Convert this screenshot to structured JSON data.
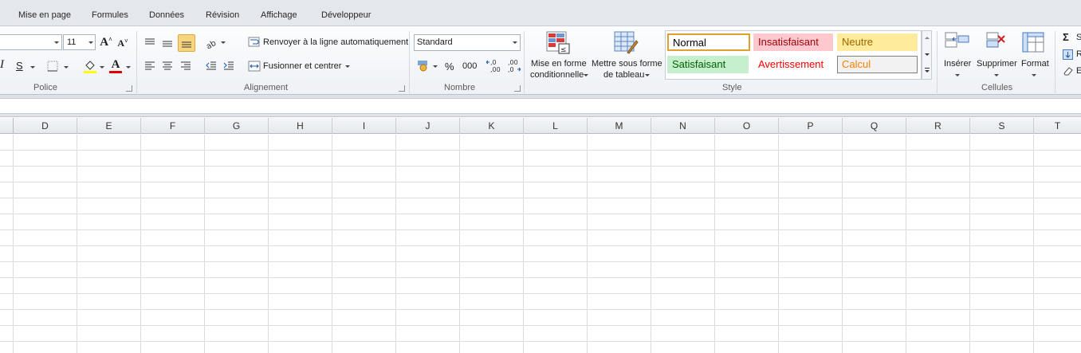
{
  "tabs": [
    "Mise en page",
    "Formules",
    "Données",
    "Révision",
    "Affichage",
    "Développeur"
  ],
  "police": {
    "font_size": "11",
    "grow_label": "A",
    "shrink_label": "A",
    "italic_label": "I",
    "strike_label": "S",
    "font_color_label": "A",
    "group_label": "Police"
  },
  "alignement": {
    "wrap_label": "Renvoyer à la ligne automatiquement",
    "merge_label": "Fusionner et centrer",
    "group_label": "Alignement"
  },
  "nombre": {
    "format_value": "Standard",
    "percent_label": "%",
    "thousands_label": "000",
    "inc_decimal_label": ",0",
    "inc_decimal_sub": ",00",
    "dec_decimal_label": ",00",
    "dec_decimal_sub": ",0",
    "group_label": "Nombre"
  },
  "style": {
    "conditional_line1": "Mise en forme",
    "conditional_line2": "conditionnelle",
    "table_line1": "Mettre sous forme",
    "table_line2": "de tableau",
    "group_label": "Style",
    "cells": [
      {
        "label": "Normal",
        "bg": "#ffffff",
        "color": "#000000",
        "border": "#e0a030"
      },
      {
        "label": "Insatisfaisant",
        "bg": "#ffc7ce",
        "color": "#9c0006",
        "border": "#ffc7ce"
      },
      {
        "label": "Neutre",
        "bg": "#ffeb9c",
        "color": "#9c6500",
        "border": "#ffeb9c"
      },
      {
        "label": "Satisfaisant",
        "bg": "#c6efce",
        "color": "#006100",
        "border": "#c6efce"
      },
      {
        "label": "Avertissement",
        "bg": "#ffffff",
        "color": "#ff0000",
        "border": "#ffffff"
      },
      {
        "label": "Calcul",
        "bg": "#f2f2f2",
        "color": "#fa7d00",
        "border": "#7f7f7f"
      }
    ]
  },
  "cellules": {
    "insert_label": "Insérer",
    "delete_label": "Supprimer",
    "format_label": "Format",
    "group_label": "Cellules"
  },
  "edition": {
    "sum_label": "S",
    "fill_label": "R",
    "clear_label": "E"
  },
  "columns": [
    "D",
    "E",
    "F",
    "G",
    "H",
    "I",
    "J",
    "K",
    "L",
    "M",
    "N",
    "O",
    "P",
    "Q",
    "R",
    "S",
    "T"
  ],
  "colors": {
    "accent_highlight": "#f5c76a",
    "font_color_bar": "#e00000",
    "fill_color_bar": "#ffff00"
  }
}
